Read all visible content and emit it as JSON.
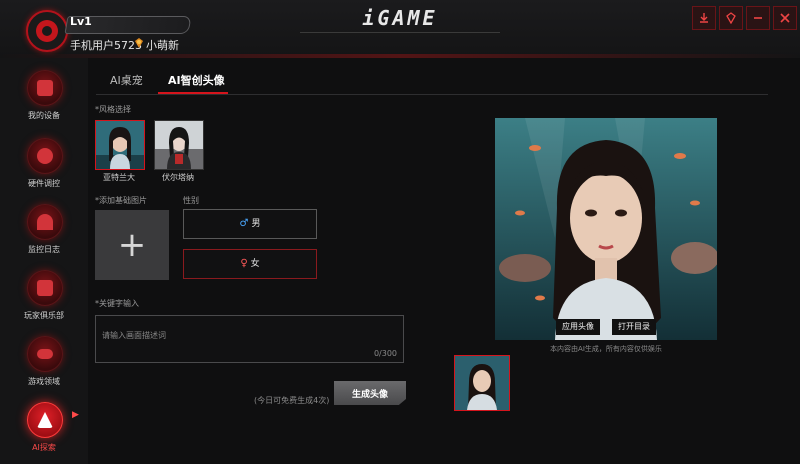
{
  "header": {
    "level": "Lv1",
    "username": "手机用户5723",
    "nickname": "小萌新",
    "logo": "iGAME",
    "window_buttons": [
      "download-icon",
      "skin-icon",
      "minimize-icon",
      "close-icon"
    ]
  },
  "sidebar": {
    "items": [
      {
        "label": "我的设备",
        "icon": "monitor-icon"
      },
      {
        "label": "硬件调控",
        "icon": "chip-icon"
      },
      {
        "label": "监控日志",
        "icon": "gauge-icon"
      },
      {
        "label": "玩家俱乐部",
        "icon": "club-icon"
      },
      {
        "label": "游戏领域",
        "icon": "gamepad-icon"
      },
      {
        "label": "AI探索",
        "icon": "ai-icon",
        "active": true
      }
    ]
  },
  "tabs": [
    {
      "label": "AI桌宠"
    },
    {
      "label": "AI智创头像",
      "active": true
    }
  ],
  "style_section": {
    "label": "*风格选择",
    "styles": [
      {
        "name": "亚特兰大",
        "selected": true
      },
      {
        "name": "伏尔塔纳",
        "selected": false
      }
    ]
  },
  "upload": {
    "label": "*添加基础图片",
    "plus": "+"
  },
  "gender": {
    "label": "性别",
    "male": "男",
    "female": "女",
    "male_symbol": "♂",
    "female_symbol": "♀",
    "selected": "female"
  },
  "keyword": {
    "label": "*关键字输入",
    "placeholder": "请输入画面描述词",
    "value": "",
    "counter": "0/300"
  },
  "generate": {
    "free_count": "(今日可免费生成4次)",
    "button": "生成头像"
  },
  "preview": {
    "apply": "应用头像",
    "open_dir": "打开目录",
    "note": "本内容由AI生成，所有内容仅供娱乐"
  },
  "colors": {
    "accent": "#d5141c",
    "background": "#0f0f10",
    "panel": "#151516"
  }
}
